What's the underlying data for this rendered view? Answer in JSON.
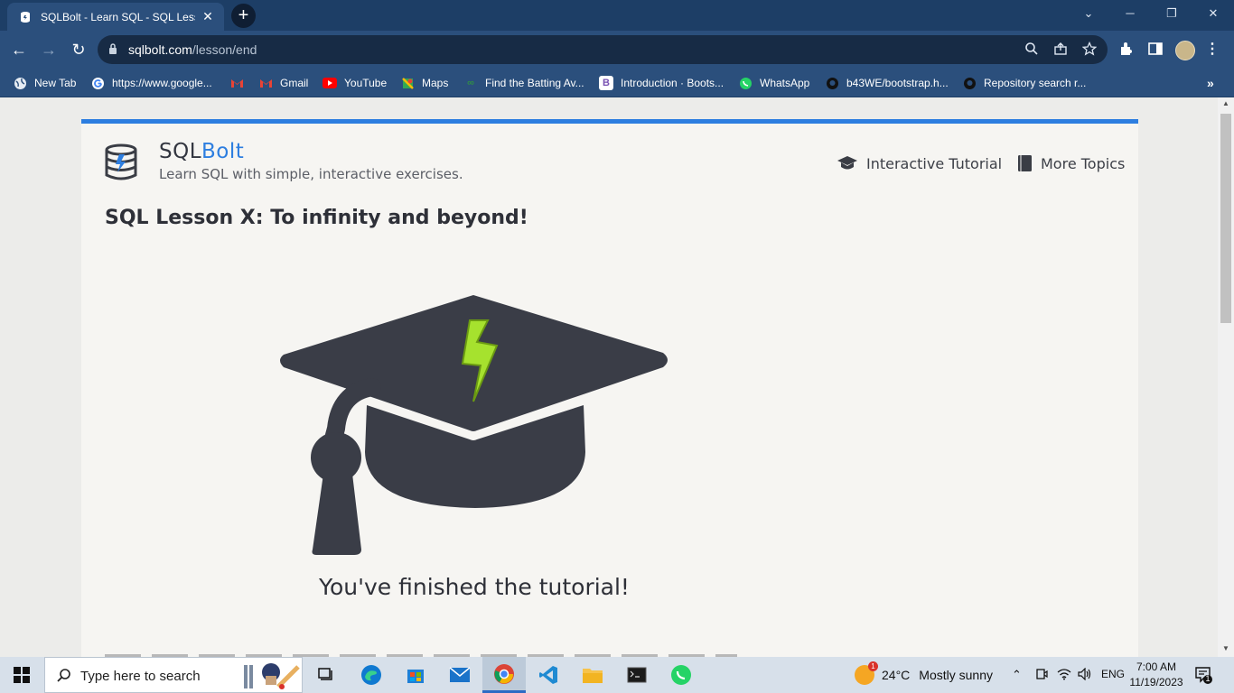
{
  "browser": {
    "tab_title": "SQLBolt - Learn SQL - SQL Lesso",
    "url_host": "sqlbolt.com",
    "url_path": "/lesson/end",
    "bookmarks": [
      {
        "label": "New Tab",
        "icon": "globe-icon"
      },
      {
        "label": "https://www.google...",
        "icon": "google-icon"
      },
      {
        "label": "",
        "icon": "gmail-icon"
      },
      {
        "label": "Gmail",
        "icon": "gmail-icon"
      },
      {
        "label": "YouTube",
        "icon": "youtube-icon"
      },
      {
        "label": "Maps",
        "icon": "maps-icon"
      },
      {
        "label": "Find the Batting Av...",
        "icon": "gfg-icon"
      },
      {
        "label": "Introduction · Boots...",
        "icon": "bootstrap-icon"
      },
      {
        "label": "WhatsApp",
        "icon": "whatsapp-icon"
      },
      {
        "label": "b43WE/bootstrap.h...",
        "icon": "github-icon"
      },
      {
        "label": "Repository search r...",
        "icon": "github-icon"
      }
    ],
    "bookmark_icon_letters": {
      "bootstrap": "B"
    }
  },
  "site": {
    "brand_prefix": "SQL",
    "brand_suffix": "Bolt",
    "tagline": "Learn SQL with simple, interactive exercises.",
    "nav": [
      {
        "label": "Interactive Tutorial",
        "icon": "graduation-cap-icon"
      },
      {
        "label": "More Topics",
        "icon": "book-icon"
      }
    ],
    "lesson_title": "SQL Lesson X: To infinity and beyond!",
    "finished_message": "You've finished the tutorial!",
    "accent_color": "#2d7ee0",
    "bolt_color": "#a6e22e"
  },
  "taskbar": {
    "search_placeholder": "Type here to search",
    "weather_temp": "24°C",
    "weather_desc": "Mostly sunny",
    "weather_badge": "1",
    "language": "ENG",
    "time": "7:00 AM",
    "date": "11/19/2023",
    "notification_count": "1"
  }
}
